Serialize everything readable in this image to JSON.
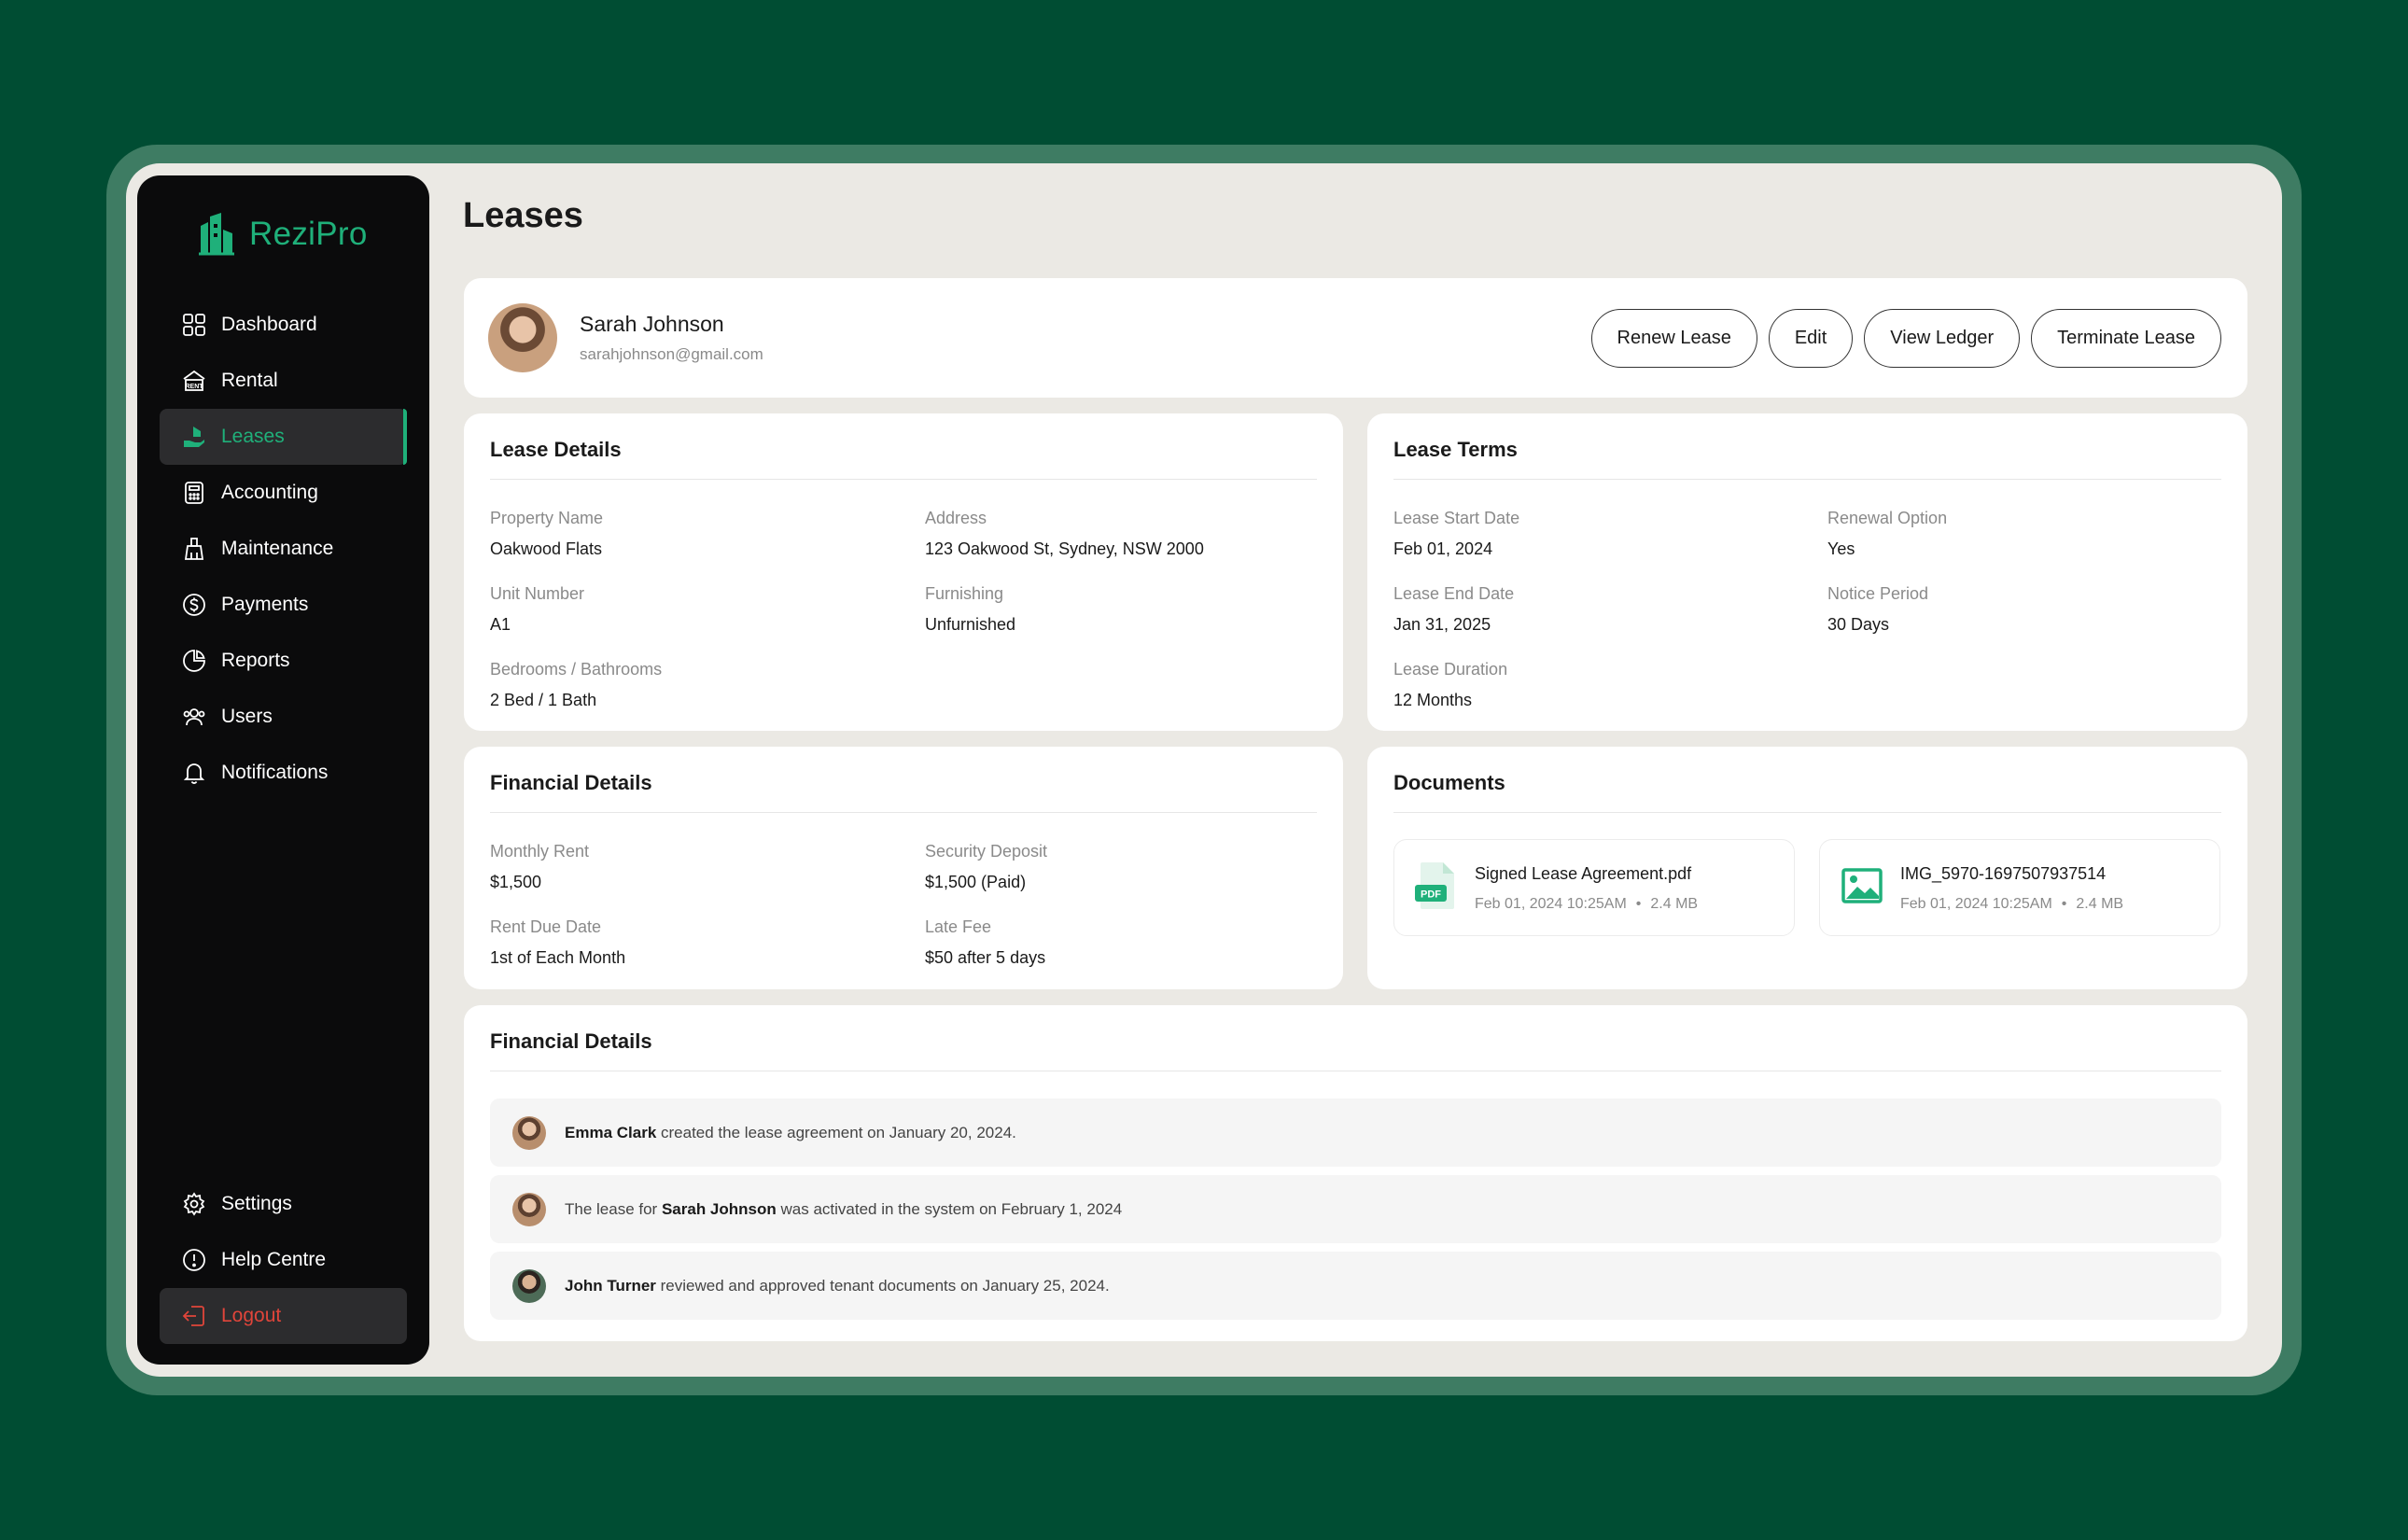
{
  "app": {
    "name": "ReziPro"
  },
  "colors": {
    "brand": "#1fb07a",
    "background": "#004d33",
    "logout": "#e0453a"
  },
  "sidebar": {
    "items": [
      {
        "label": "Dashboard",
        "icon": "dashboard-grid-icon"
      },
      {
        "label": "Rental",
        "icon": "rent-house-icon"
      },
      {
        "label": "Leases",
        "icon": "lease-hand-house-icon",
        "active": true
      },
      {
        "label": "Accounting",
        "icon": "calculator-icon"
      },
      {
        "label": "Maintenance",
        "icon": "broom-icon"
      },
      {
        "label": "Payments",
        "icon": "dollar-circle-icon"
      },
      {
        "label": "Reports",
        "icon": "pie-chart-icon"
      },
      {
        "label": "Users",
        "icon": "users-icon"
      },
      {
        "label": "Notifications",
        "icon": "bell-icon"
      }
    ],
    "bottom": [
      {
        "label": "Settings",
        "icon": "gear-icon"
      },
      {
        "label": "Help Centre",
        "icon": "info-circle-icon"
      },
      {
        "label": "Logout",
        "icon": "logout-icon"
      }
    ]
  },
  "page": {
    "title": "Leases"
  },
  "tenant": {
    "name": "Sarah Johnson",
    "email": "sarahjohnson@gmail.com",
    "actions": {
      "renew": "Renew Lease",
      "edit": "Edit",
      "ledger": "View Ledger",
      "terminate": "Terminate Lease"
    }
  },
  "lease_details": {
    "title": "Lease Details",
    "property_name": {
      "label": "Property Name",
      "value": "Oakwood Flats"
    },
    "address": {
      "label": "Address",
      "value": "123 Oakwood St, Sydney, NSW 2000"
    },
    "unit_number": {
      "label": "Unit Number",
      "value": "A1"
    },
    "furnishing": {
      "label": "Furnishing",
      "value": "Unfurnished"
    },
    "bed_bath": {
      "label": "Bedrooms / Bathrooms",
      "value": "2 Bed / 1 Bath"
    }
  },
  "lease_terms": {
    "title": "Lease Terms",
    "start_date": {
      "label": "Lease Start Date",
      "value": "Feb 01, 2024"
    },
    "renewal_option": {
      "label": "Renewal Option",
      "value": "Yes"
    },
    "end_date": {
      "label": "Lease End Date",
      "value": "Jan 31, 2025"
    },
    "notice_period": {
      "label": "Notice Period",
      "value": "30 Days"
    },
    "duration": {
      "label": "Lease Duration",
      "value": "12 Months"
    }
  },
  "financial_details": {
    "title": "Financial Details",
    "monthly_rent": {
      "label": "Monthly Rent",
      "value": "$1,500"
    },
    "security_deposit": {
      "label": "Security Deposit",
      "value": "$1,500 (Paid)"
    },
    "rent_due_date": {
      "label": "Rent Due Date",
      "value": "1st of Each Month"
    },
    "late_fee": {
      "label": "Late Fee",
      "value": "$50 after 5 days"
    }
  },
  "documents": {
    "title": "Documents",
    "files": [
      {
        "name": "Signed Lease Agreement.pdf",
        "date": "Feb 01, 2024 10:25AM",
        "size": "2.4 MB",
        "icon": "pdf-file-icon",
        "badge": "PDF"
      },
      {
        "name": "IMG_5970-1697507937514",
        "date": "Feb 01, 2024 10:25AM",
        "size": "2.4 MB",
        "icon": "image-file-icon"
      }
    ]
  },
  "activity": {
    "title": "Financial Details",
    "rows": [
      {
        "bold": "Emma Clark",
        "text": " created the lease agreement on January 20, 2024."
      },
      {
        "pre": "The lease for ",
        "bold": "Sarah Johnson",
        "text": " was activated in the system on February 1, 2024"
      },
      {
        "bold": "John Turner",
        "text": " reviewed and approved tenant documents on January 25, 2024."
      }
    ]
  }
}
